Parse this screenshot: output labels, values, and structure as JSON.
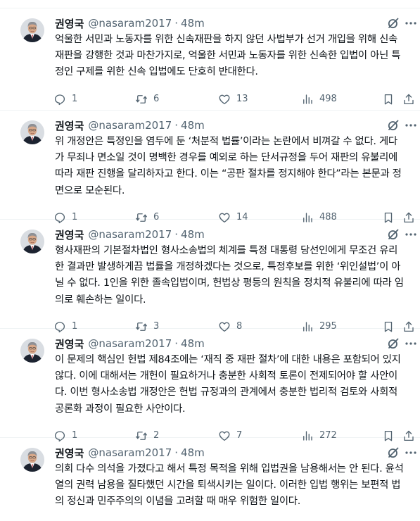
{
  "tweets": [
    {
      "name": "권영국",
      "handle": "@nasaram2017",
      "dot": "·",
      "time": "48m",
      "lines": [
        "억울한 서민과 노동자를 위한 신속재판을 하지 않던 사법부가 선거 개입을 위해 신속",
        "재판을 강행한 것과 마찬가지로, 억울한 서민과 노동자를 위한 신속한 입법이 아닌 특",
        "정인 구제를 위한 신속 입법에도 단호히 반대한다."
      ],
      "replies": "1",
      "retweets": "6",
      "likes": "13",
      "views": "498"
    },
    {
      "name": "권영국",
      "handle": "@nasaram2017",
      "dot": "·",
      "time": "48m",
      "lines": [
        "위 개정안은 특정인을 염두에 둔 ‘처분적 법률’이라는 논란에서 비껴갈 수 없다. 게다",
        "가 무죄나 면소일 것이 명백한 경우를 예외로 하는 단서규정을 두어 재판의 유불리에",
        "따라 재판 진행을 달리하자고 한다. 이는 “공판 절차를 정지해야 한다”라는 본문과 정",
        "면으로 모순된다."
      ],
      "replies": "1",
      "retweets": "6",
      "likes": "14",
      "views": "488"
    },
    {
      "name": "권영국",
      "handle": "@nasaram2017",
      "dot": "·",
      "time": "48m",
      "lines": [
        "형사재판의 기본절차법인 형사소송법의 체계를 특정 대통령 당선인에게 무조건 유리",
        "한 결과만 발생하게끔 법률을 개정하겠다는 것으로, 특정후보를 위한 ‘위인설법’이 아",
        "닐 수 없다. 1인을 위한 졸속입법이며, 헌법상 평등의 원칙을 정치적 유불리에 따라 임",
        "의로 훼손하는 일이다."
      ],
      "replies": "1",
      "retweets": "3",
      "likes": "8",
      "views": "295"
    },
    {
      "name": "권영국",
      "handle": "@nasaram2017",
      "dot": "·",
      "time": "48m",
      "lines": [
        "이 문제의 핵심인 헌법 제84조에는 ‘재직 중 재판 절차’에 대한 내용은 포함되어 있지",
        "않다. 이에 대해서는 개헌이 필요하거나 충분한 사회적 토론이 전제되어야 할 사안이",
        "다. 이번 형사소송법 개정안은 헌법 규정과의 관계에서 충분한 법리적 검토와 사회적",
        "공론화 과정이 필요한 사안이다."
      ],
      "replies": "1",
      "retweets": "2",
      "likes": "7",
      "views": "272"
    },
    {
      "name": "권영국",
      "handle": "@nasaram2017",
      "dot": "·",
      "time": "48m",
      "lines": [
        "의회 다수 의석을 가졌다고 해서 특정 목적을 위해 입법권을 남용해서는 안 된다. 윤석",
        "열의 권력 남용을 질타했던 시간을 퇴색시키는 일이다. 이러한 입법 행위는 보편적 법",
        "의 정신과 민주주의의 이념을 고려할 때 매우 위험한 일이다."
      ],
      "replies": "2",
      "retweets": "4",
      "likes": "7",
      "views": "556"
    }
  ],
  "icons": {
    "avatar": "profile-photo",
    "grok": "grok-icon",
    "more": "more-icon",
    "reply": "reply-icon",
    "retweet": "retweet-icon",
    "like": "heart-icon",
    "views": "views-icon",
    "bookmark": "bookmark-icon",
    "share": "share-icon"
  }
}
